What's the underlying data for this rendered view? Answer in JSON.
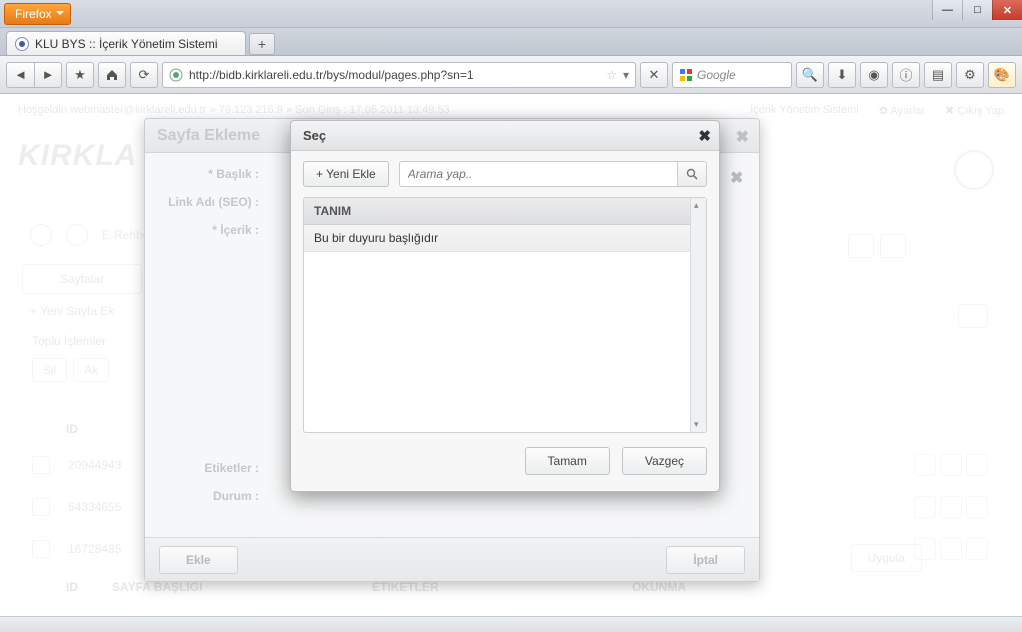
{
  "window": {
    "min": "—",
    "max": "□",
    "close": "✕"
  },
  "browser": {
    "menu_button": "Firefox",
    "tab_title": "KLU BYS :: İçerik Yönetim Sistemi",
    "url": "http://bidb.kirklareli.edu.tr/bys/modul/pages.php?sn=1",
    "search_placeholder": "Google"
  },
  "bg": {
    "welcome": "Hoşgeldin webmaster@kirklareli.edu.tr » 79.123.216.9 » Son Giriş : 17.05.2011 13:49:53",
    "right_menu": {
      "sys": "İçerik Yönetim Sistemi",
      "settings": "✿ Ayarlar",
      "logout": "✖ Çıkış Yap"
    },
    "logo": "KIRKLA",
    "erehber": "E-Rehber",
    "tab": "Sayfalar",
    "add_page": "+ Yeni Sayfa Ek",
    "toplu": "Toplu İşlemler",
    "sil": "Sil",
    "ak": "Ak",
    "uygula": "Uygula",
    "th_id": "ID",
    "th_title": "SAYFA BAŞLIĞI",
    "th_tags": "ETİKETLER",
    "th_reads": "OKUNMA",
    "ids": [
      "20944943",
      "54334655",
      "16728485"
    ]
  },
  "back_dialog": {
    "title": "Sayfa Ekleme",
    "lbl_title": "* Başlık :",
    "lbl_seo": "Link Adı (SEO) :",
    "lbl_content": "* İçerik :",
    "lbl_tags": "Etiketler :",
    "lbl_status": "Durum :",
    "btn_add": "Ekle",
    "btn_cancel": "İptal"
  },
  "front_dialog": {
    "title": "Seç",
    "new_btn": "+ Yeni Ekle",
    "search_placeholder": "Arama yap..",
    "col_header": "TANIM",
    "row0": "Bu bir duyuru başlığıdır",
    "ok": "Tamam",
    "cancel": "Vazgeç"
  }
}
